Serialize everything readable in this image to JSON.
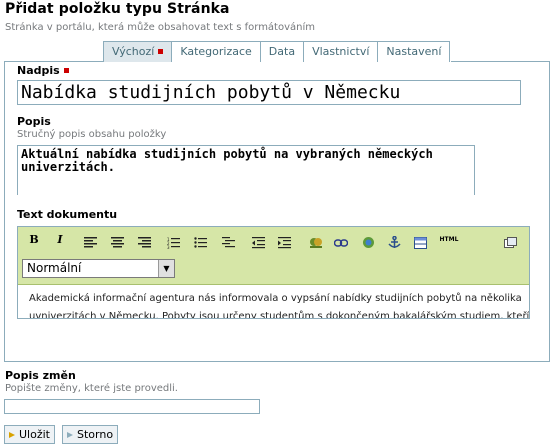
{
  "header": {
    "title": "Přidat položku typu Stránka",
    "description": "Stránka v portálu, která může obsahovat text s formátováním"
  },
  "tabs": [
    {
      "label": "Výchozí",
      "active": true,
      "required": true
    },
    {
      "label": "Kategorizace"
    },
    {
      "label": "Data"
    },
    {
      "label": "Vlastnictví"
    },
    {
      "label": "Nastavení"
    }
  ],
  "fields": {
    "title": {
      "label": "Nadpis",
      "value": "Nabídka studijních pobytů v Německu"
    },
    "description": {
      "label": "Popis",
      "help": "Stručný popis obsahu položky",
      "value": "Aktuální nabídka studijních pobytů na vybraných německých univerzitách."
    },
    "text": {
      "label": "Text dokumentu",
      "format_select": "Normální",
      "content_line1": "Akademická informační agentura nás informovala o vypsání nabídky studijních pobytů na několika",
      "content_line2": "uvniverzitách v Německu. Pobyty jsou určeny studentům s dokončeným bakalářským studiem, kteří"
    },
    "changes": {
      "label": "Popis změn",
      "help": "Popište změny, které jste provedli."
    }
  },
  "toolbar": {
    "bold": "B",
    "italic": "I",
    "html_label": "HTML",
    "icons": [
      "bold-icon",
      "italic-icon",
      "align-left-icon",
      "align-center-icon",
      "align-right-icon",
      "numbered-list-icon",
      "bullet-list-icon",
      "definition-list-icon",
      "outdent-icon",
      "indent-icon",
      "image-icon",
      "link-icon",
      "external-link-icon",
      "anchor-icon",
      "table-icon",
      "html-source-icon",
      "fullscreen-icon"
    ]
  },
  "buttons": {
    "save": "Uložit",
    "cancel": "Storno"
  },
  "colors": {
    "border": "#8cacbb",
    "link": "#436976",
    "active_tab": "#dee7ec",
    "toolbar_bg": "#d6e6a7",
    "required": "#cc0000"
  }
}
